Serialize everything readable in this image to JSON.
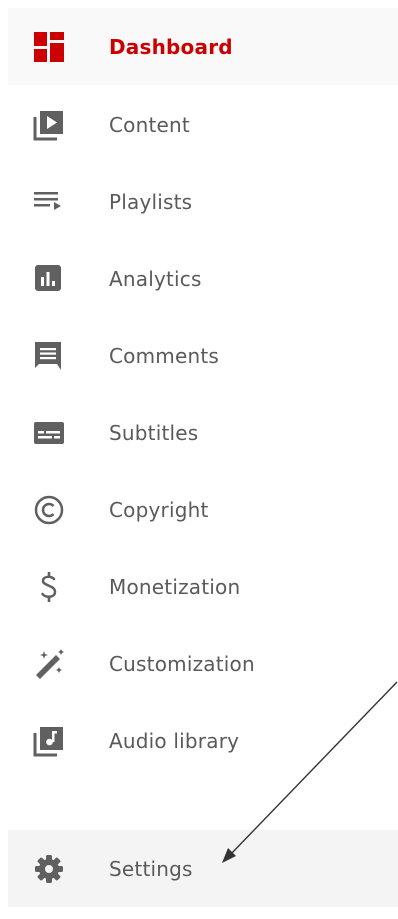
{
  "nav": {
    "items": [
      {
        "label": "Dashboard",
        "icon": "dashboard-icon",
        "active": true
      },
      {
        "label": "Content",
        "icon": "content-video-icon"
      },
      {
        "label": "Playlists",
        "icon": "playlists-icon"
      },
      {
        "label": "Analytics",
        "icon": "analytics-icon"
      },
      {
        "label": "Comments",
        "icon": "comments-icon"
      },
      {
        "label": "Subtitles",
        "icon": "subtitles-icon"
      },
      {
        "label": "Copyright",
        "icon": "copyright-icon"
      },
      {
        "label": "Monetization",
        "icon": "dollar-icon"
      },
      {
        "label": "Customization",
        "icon": "magic-wand-icon"
      },
      {
        "label": "Audio library",
        "icon": "audio-library-icon"
      }
    ],
    "settings": {
      "label": "Settings",
      "icon": "gear-icon"
    }
  },
  "colors": {
    "accent": "#cc0000",
    "icon_gray": "#606060",
    "label_gray": "#5a5a5a"
  }
}
